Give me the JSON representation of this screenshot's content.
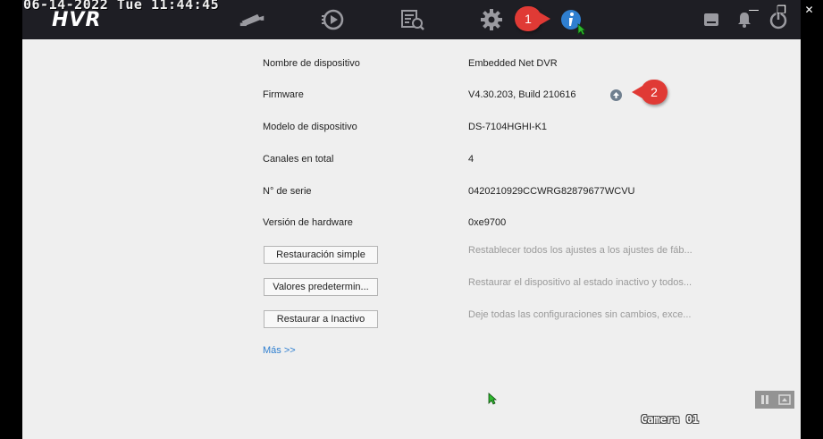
{
  "osd": {
    "datetime": "06-14-2022 Tue 11:44:45",
    "camera": "Camera 01"
  },
  "header": {
    "logo": "HVR",
    "nav_icons": [
      "camera-icon",
      "playback-icon",
      "search-icon",
      "settings-icon",
      "info-icon"
    ],
    "right_icons": [
      "storage-icon",
      "bell-icon",
      "power-icon"
    ],
    "active_icon": "info-icon",
    "active_color": "#2f7fd0"
  },
  "window": {
    "minimize": "—",
    "restore": "❐",
    "close": "✕"
  },
  "annotations": {
    "badge1": "1",
    "badge2": "2",
    "badge_color": "#e03a35"
  },
  "info": {
    "rows": [
      {
        "label": "Nombre de dispositivo",
        "value": "Embedded Net DVR"
      },
      {
        "label": "Firmware",
        "value": "V4.30.203, Build 210616"
      },
      {
        "label": "Modelo de dispositivo",
        "value": "DS-7104HGHI-K1"
      },
      {
        "label": "Canales en total",
        "value": "4"
      },
      {
        "label": "N° de serie",
        "value": "0420210929CCWRG82879677WCVU"
      },
      {
        "label": "Versión de hardware",
        "value": "0xe9700"
      }
    ],
    "actions": [
      {
        "label": "Restauración simple",
        "desc": "Restablecer todos los ajustes a los ajustes de fáb..."
      },
      {
        "label": "Valores predetermin...",
        "desc": "Restaurar el dispositivo al estado inactivo y todos..."
      },
      {
        "label": "Restaurar a Inactivo",
        "desc": "Deje todas las configuraciones sin cambios, exce..."
      }
    ],
    "more_link": "Más >>"
  }
}
